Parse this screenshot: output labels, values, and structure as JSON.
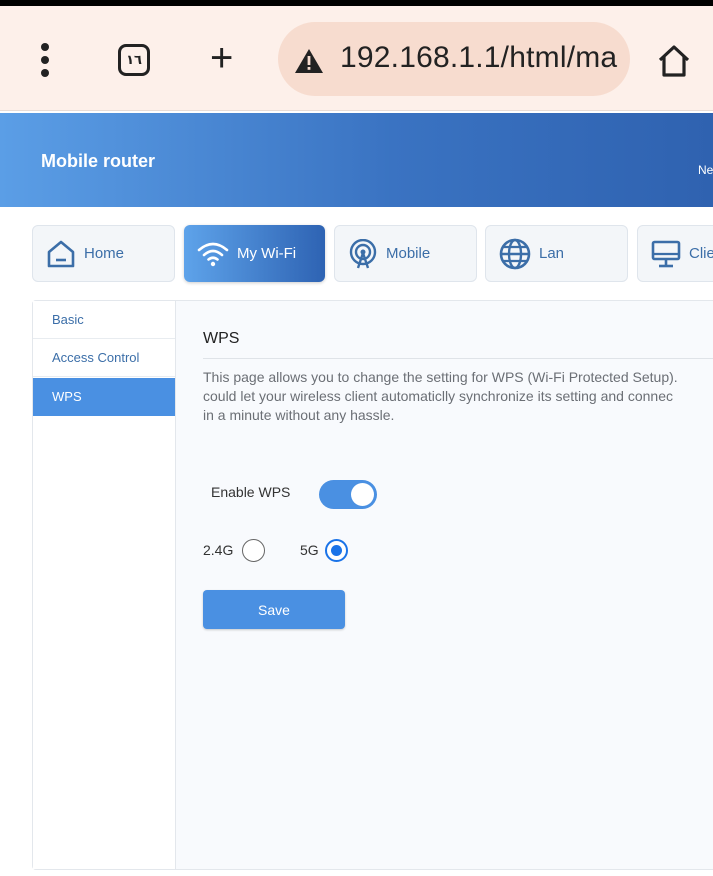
{
  "browser": {
    "tab_count": "١٦",
    "url": "192.168.1.1/html/ma",
    "icons": [
      "kebab-menu-icon",
      "tabs-icon",
      "plus-icon",
      "warning-icon",
      "home-icon"
    ]
  },
  "header": {
    "title": "Mobile router",
    "right_fragment": "Ne"
  },
  "nav": {
    "tabs": [
      {
        "label": "Home",
        "icon": "home-icon"
      },
      {
        "label": "My Wi-Fi",
        "icon": "wifi-icon",
        "active": true
      },
      {
        "label": "Mobile",
        "icon": "antenna-icon"
      },
      {
        "label": "Lan",
        "icon": "globe-icon"
      },
      {
        "label": "Clie",
        "icon": "monitor-icon"
      }
    ]
  },
  "sidebar": {
    "items": [
      {
        "label": "Basic"
      },
      {
        "label": "Access Control"
      },
      {
        "label": "WPS",
        "active": true
      }
    ]
  },
  "main": {
    "title": "WPS",
    "description": [
      "This page allows you to change the setting for WPS (Wi-Fi Protected Setup).",
      "could let your wireless client automaticlly synchronize its setting and connec",
      "in a minute without any hassle."
    ],
    "enable_label": "Enable WPS",
    "enable_on": true,
    "band_options": [
      {
        "label": "2.4G",
        "checked": false
      },
      {
        "label": "5G",
        "checked": true
      }
    ],
    "save_label": "Save"
  },
  "colors": {
    "accent": "#4a90e2",
    "header_start": "#5b9ee6",
    "header_end": "#2f62b0",
    "radio_checked": "#1a73e8"
  }
}
